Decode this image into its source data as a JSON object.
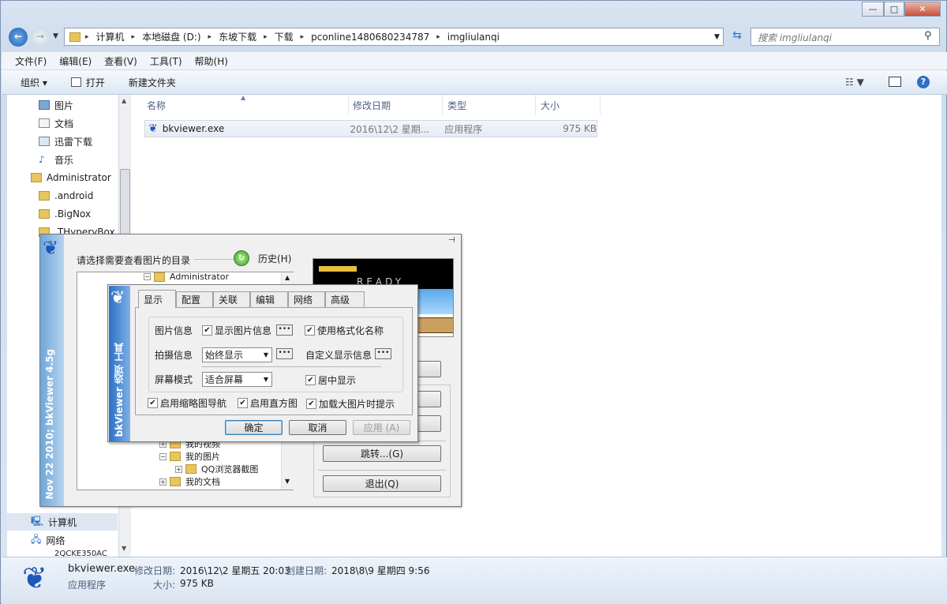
{
  "window": {
    "caption_buttons": [
      "—",
      "□",
      "✕"
    ]
  },
  "address": {
    "crumbs": [
      "计算机",
      "本地磁盘 (D:)",
      "东坡下载",
      "下载",
      "pconline1480680234787",
      "imgliulanqi"
    ],
    "search_placeholder": "搜索 imgliulanqi"
  },
  "menu": [
    "文件(F)",
    "编辑(E)",
    "查看(V)",
    "工具(T)",
    "帮助(H)"
  ],
  "toolbar": {
    "organize": "组织 ▾",
    "open": "打开",
    "new_folder": "新建文件夹"
  },
  "nav": {
    "items": [
      "图片",
      "文档",
      "迅雷下载",
      "音乐",
      "Administrator",
      ".android",
      ".BigNox",
      ".THyperyBox"
    ],
    "bottom_items": [
      "计算机",
      "网络",
      "2QCKE350AC"
    ]
  },
  "columns": [
    "名称",
    "修改日期",
    "类型",
    "大小"
  ],
  "file": {
    "name": "bkviewer.exe",
    "date": "2016\\12\\2 星期...",
    "type": "应用程序",
    "size": "975 KB"
  },
  "status": {
    "name": "bkviewer.exe",
    "modified_label": "修改日期:",
    "modified": "2016\\12\\2 星期五 20:03",
    "created_label": "创建日期:",
    "created": "2018\\8\\9 星期四 9:56",
    "type": "应用程序",
    "size_label": "大小:",
    "size": "975 KB"
  },
  "bk_main": {
    "side_text": "Nov 22 2010;  bkViewer 4.5g",
    "prompt": "请选择需要查看图片的目录",
    "history": "历史(H)",
    "preview_text": "READY",
    "jump": "跳转...(G)",
    "exit": "退出(Q)",
    "tree": [
      "Administrator",
      "我的视频",
      "我的图片",
      "QQ浏览器截图",
      "我的文档"
    ]
  },
  "options": {
    "side_text": "bkViewer 选项 工具",
    "tabs": [
      "显示",
      "配置",
      "关联",
      "编辑",
      "网络",
      "高级"
    ],
    "pic_info_label": "图片信息",
    "show_pic_info": "显示图片信息",
    "use_format_name": "使用格式化名称",
    "shoot_info_label": "拍摄信息",
    "shoot_info_value": "始终显示",
    "custom_info": "自定义显示信息",
    "screen_mode_label": "屏幕模式",
    "screen_mode_value": "适合屏幕",
    "center_display": "居中显示",
    "thumb_nav": "启用缩略图导航",
    "histogram": "启用直方图",
    "big_pic_hint": "加载大图片时提示",
    "ok": "确定",
    "cancel": "取消",
    "apply": "应用 (A)",
    "dots": "•••",
    "check": "✔"
  }
}
